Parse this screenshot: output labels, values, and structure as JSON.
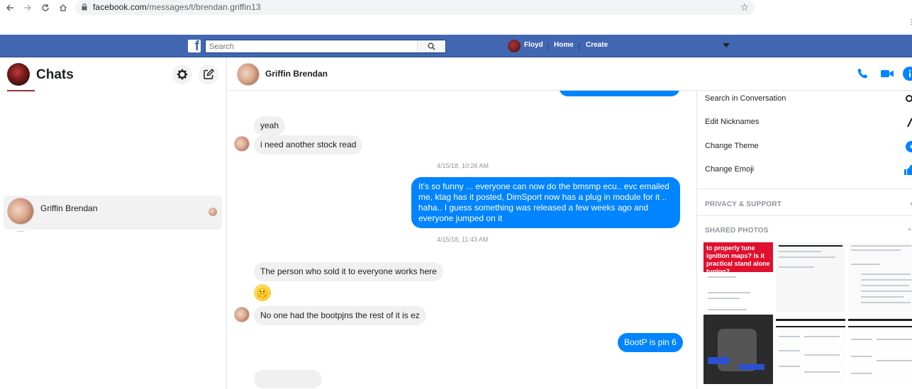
{
  "browser": {
    "url_host": "facebook.com",
    "url_path": "/messages/t/brendan.griffin13"
  },
  "fb_bar": {
    "search_placeholder": "Search",
    "user_name": "Floyd",
    "home_label": "Home",
    "create_label": "Create"
  },
  "sidebar": {
    "title": "Chats",
    "conversations": [
      {
        "name": "Griffin Brendan"
      }
    ]
  },
  "conversation": {
    "contact_name": "Griffin Brendan",
    "messages": [
      {
        "from": "them",
        "text": "yeah"
      },
      {
        "from": "them",
        "text": "i need another stock read"
      },
      {
        "type": "timestamp",
        "text": "4/15/18, 10:26 AM"
      },
      {
        "from": "me",
        "text": "It's so funny ... everyone can now do the bmsmp ecu.. evc emailed me, ktag has it posted, DimSport now has a plug in module for it .. haha.. I guess something was released a few weeks ago and everyone jumped on it"
      },
      {
        "type": "timestamp",
        "text": "4/15/18, 11:43 AM"
      },
      {
        "from": "them",
        "text": "The person who sold it to everyone works here"
      },
      {
        "from": "them",
        "type": "emoji",
        "emoji": "🤫"
      },
      {
        "from": "them",
        "text": "No one had the bootpjns the rest of it is ez"
      },
      {
        "from": "me",
        "text": "BootP is pin 6"
      }
    ]
  },
  "info_panel": {
    "options": [
      {
        "label": "Search in Conversation",
        "icon": "search-icon"
      },
      {
        "label": "Edit Nicknames",
        "icon": "pencil-icon"
      },
      {
        "label": "Change Theme",
        "icon": "theme-icon"
      },
      {
        "label": "Change Emoji",
        "icon": "thumbs-up-icon"
      }
    ],
    "privacy_section": "PRIVACY & SUPPORT",
    "photos_section": "SHARED PHOTOS",
    "photo1_caption": "to properly tune ignition maps? Is it practical stand alone tuning?"
  },
  "colors": {
    "facebook_blue": "#4267b2",
    "messenger_blue": "#0084ff",
    "incoming_bubble": "#f1f0f0"
  }
}
